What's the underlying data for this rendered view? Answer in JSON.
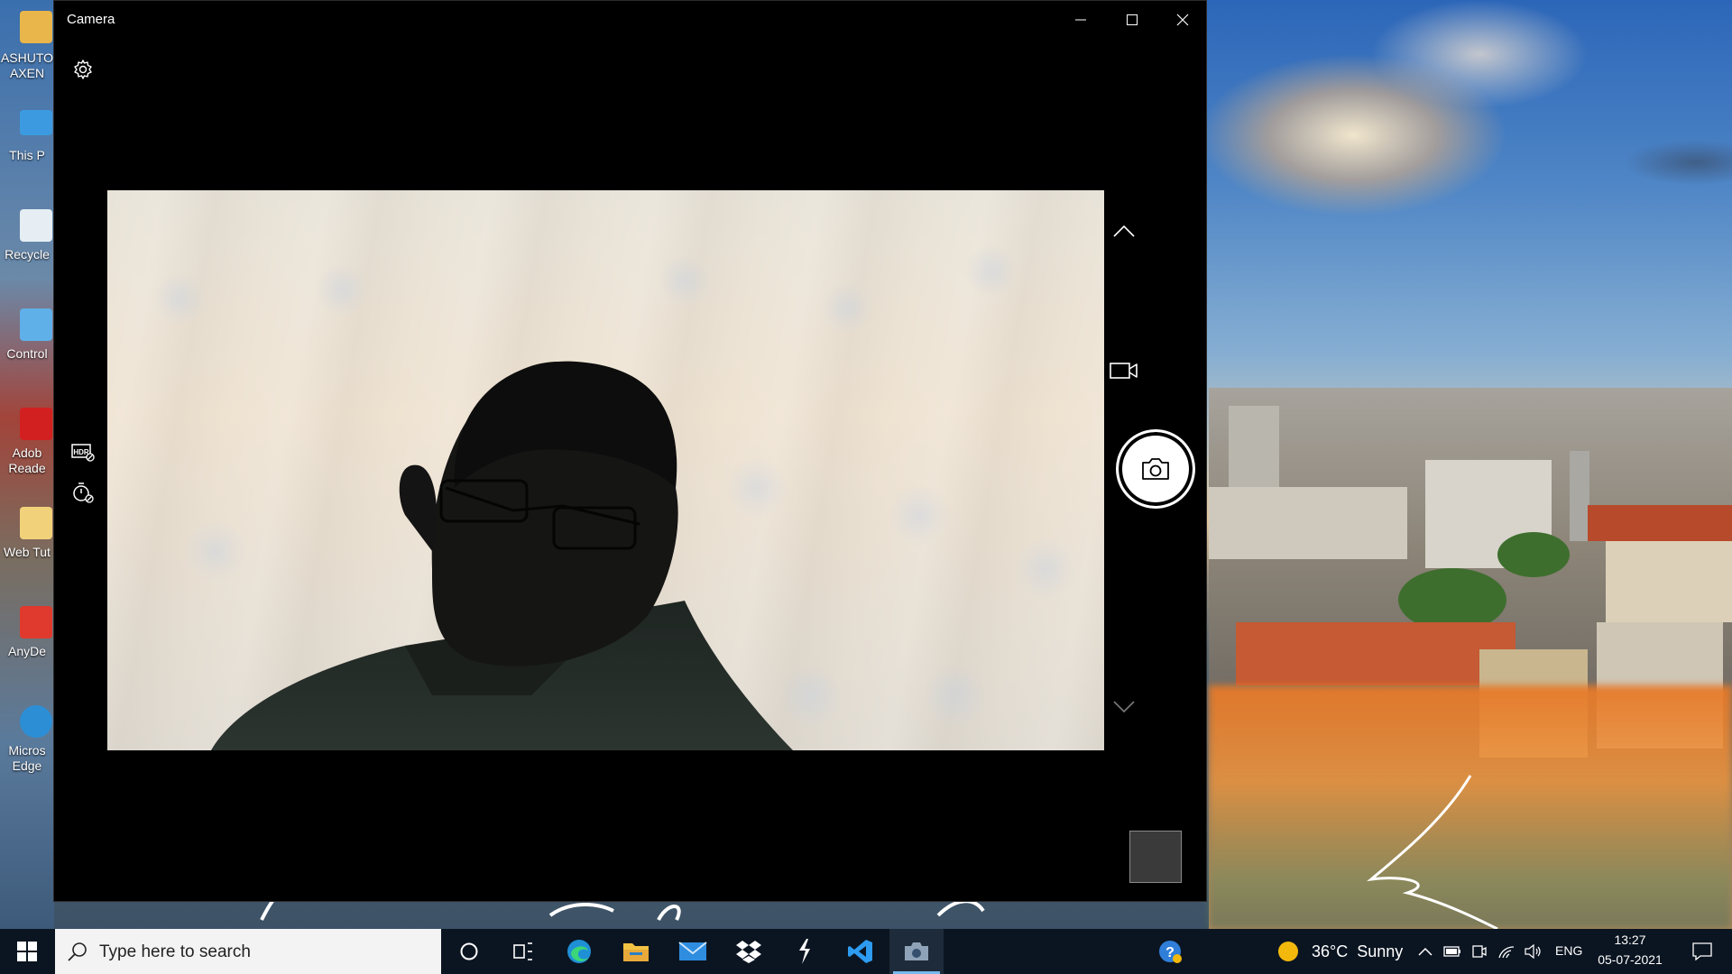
{
  "window": {
    "title": "Camera",
    "controls": [
      "minimize",
      "maximize",
      "close"
    ]
  },
  "camera": {
    "top_icons": [
      "settings-icon"
    ],
    "left_toolbar": [
      "hdr-off-icon",
      "timer-off-icon"
    ],
    "right_controls": [
      "chevron-up-icon",
      "video-mode-icon",
      "photo-shutter-icon",
      "chevron-down-icon"
    ],
    "gallery_thumbnail": "last-capture"
  },
  "desktop": {
    "icons": [
      {
        "label": "ASHUTO\nAXEN",
        "icon": "user-folder-icon"
      },
      {
        "label": "This P",
        "icon": "this-pc-icon"
      },
      {
        "label": "Recycle",
        "icon": "recycle-bin-icon"
      },
      {
        "label": "Control",
        "icon": "control-panel-icon"
      },
      {
        "label": "Adob\nReade",
        "icon": "adobe-reader-icon"
      },
      {
        "label": "Web Tut",
        "icon": "web-tutorial-icon"
      },
      {
        "label": "AnyDe",
        "icon": "anydesk-icon"
      },
      {
        "label": "Micros\nEdge",
        "icon": "edge-icon"
      }
    ]
  },
  "taskbar": {
    "search_placeholder": "Type here to search",
    "pinned": [
      "cortana-icon",
      "task-view-icon",
      "edge-icon",
      "file-explorer-icon",
      "mail-icon",
      "dropbox-icon",
      "bolt-app-icon",
      "vscode-icon",
      "camera-icon"
    ],
    "active_app": "camera-icon",
    "tray": {
      "help_icon": "help-icon",
      "weather_temp": "36°C",
      "weather_desc": "Sunny",
      "language": "ENG",
      "time": "13:27",
      "date": "05-07-2021",
      "icons": [
        "chevron-up-icon",
        "battery-icon",
        "meet-now-icon",
        "wifi-icon",
        "volume-icon",
        "notification-icon"
      ]
    }
  },
  "colors": {
    "taskbar_bg": "#0b1521",
    "window_bg": "#000000",
    "active_indicator": "#76b9ed"
  }
}
